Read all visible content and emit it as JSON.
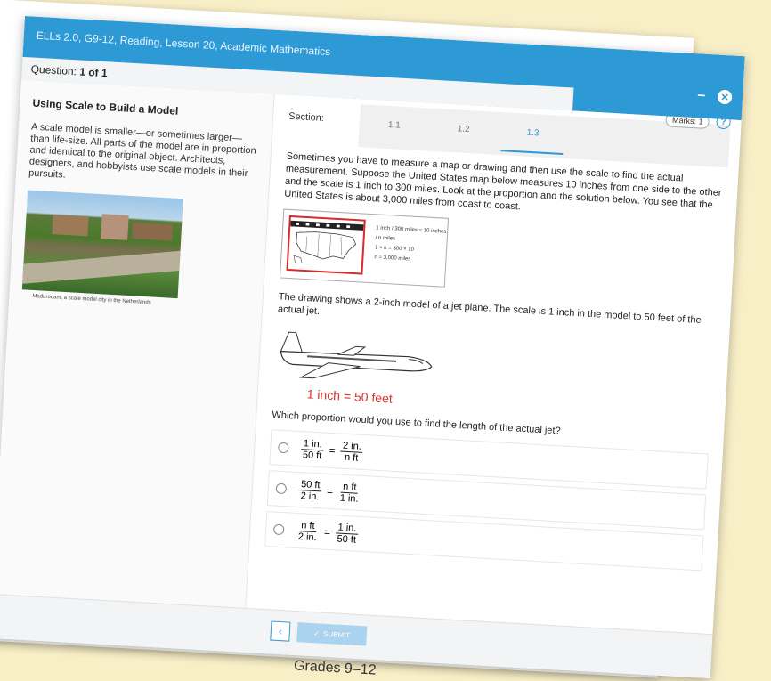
{
  "window": {
    "app_title": "ELLs 2.0, G9-12, Reading, Lesson 20, Academic Mathematics",
    "question_label": "Question:",
    "question_value": "1 of 1",
    "minimize_glyph": "–",
    "close_glyph": "✕"
  },
  "passage": {
    "title": "Using Scale to Build a Model",
    "text": "A scale model is smaller—or sometimes larger—than life-size. All parts of the model are in proportion and identical to the original object. Architects, designers, and hobbyists use scale models in their pursuits.",
    "photo_caption": "Madurodam, a scale model city in the Netherlands"
  },
  "item": {
    "section_label": "Section:",
    "tabs": [
      "1.1",
      "1.2",
      "1.3"
    ],
    "active_tab": "1.3",
    "marks": "Marks: 1",
    "help_glyph": "?",
    "paragraph1": "Sometimes you have to measure a map or drawing and then use the scale to find the actual measurement. Suppose the United States map below measures 10 inches from one side to the other and the scale is 1 inch to 300 miles. Look at the proportion and the solution below. You see that the United States is about 3,000 miles from coast to coast.",
    "map_equation": {
      "line1": "1 inch / 300 miles = 10 inches / n miles",
      "line2": "1 × n = 300 × 10",
      "line3": "n = 3,000 miles"
    },
    "paragraph2": "The drawing shows a 2-inch model of a jet plane. The scale is 1 inch in the model to 50 feet of the actual jet.",
    "jet_caption": "1 inch = 50 feet",
    "question": "Which proportion would you use to find the length of the actual jet?",
    "options": [
      {
        "n1": "1 in.",
        "d1": "50 ft",
        "n2": "2 in.",
        "d2": "n ft"
      },
      {
        "n1": "50 ft",
        "d1": "2 in.",
        "n2": "n ft",
        "d2": "1 in."
      },
      {
        "n1": "n ft",
        "d1": "2 in.",
        "n2": "1 in.",
        "d2": "50 ft"
      }
    ],
    "equals": "="
  },
  "footer": {
    "back_glyph": "‹",
    "submit_label": "SUBMIT",
    "submit_glyph": "✓"
  },
  "caption": "Grades 9–12",
  "colors": {
    "accent": "#2d9ad6",
    "caption_red": "#d9342b",
    "background": "#f8efc7"
  }
}
